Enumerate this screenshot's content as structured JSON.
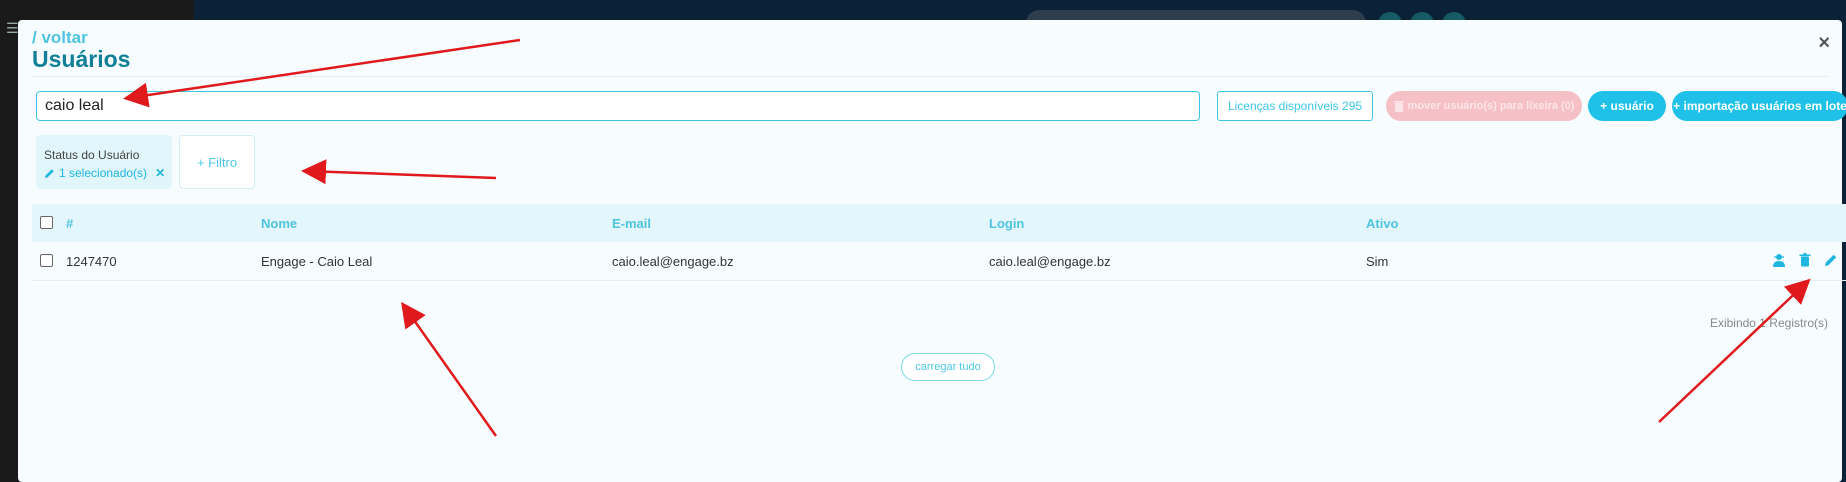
{
  "modal": {
    "back_link": "/ voltar",
    "title": "Usuários",
    "close_glyph": "×"
  },
  "toolbar": {
    "search_value": "caio leal",
    "licenses_label": "Licenças disponíveis 295",
    "trash_button_label": "mover usuário(s) para lixeira (0)",
    "add_user_label": "+ usuário",
    "bulk_import_label": "+ importação usuários em lote"
  },
  "filters": {
    "status_label": "Status do Usuário",
    "status_value": "1 selecionado(s)",
    "add_filter_label": "+ Filtro"
  },
  "table": {
    "columns": [
      "#",
      "Nome",
      "E-mail",
      "Login",
      "Ativo"
    ],
    "rows": [
      {
        "id": "1247470",
        "name": "Engage - Caio Leal",
        "email": "caio.leal@engage.bz",
        "login": "caio.leal@engage.bz",
        "active": "Sim",
        "actions": [
          "user-secret-icon",
          "trash-icon",
          "pencil-icon"
        ]
      }
    ]
  },
  "footer": {
    "records_text": "Exibindo 1 Registro(s)",
    "load_all_label": "carregar tudo"
  },
  "colors": {
    "accent": "#1fc1e8",
    "title": "#127f99",
    "annotation_arrow": "#e0191c"
  }
}
